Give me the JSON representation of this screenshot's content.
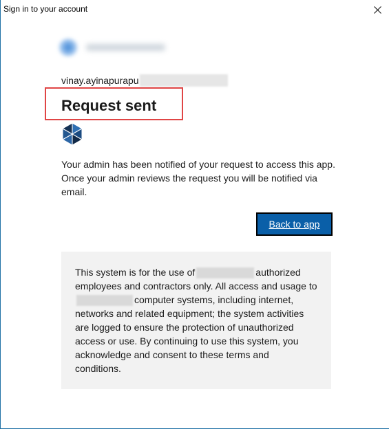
{
  "window": {
    "title": "Sign in to your account",
    "close_glyph": "close-icon"
  },
  "account": {
    "email_visible": "vinay.ayinapurapu"
  },
  "main": {
    "heading": "Request sent",
    "app_icon": "app-icon",
    "message": "Your admin has been notified of your request to access this app. Once your admin reviews the request you will be notified via email.",
    "back_button_label": "Back to app"
  },
  "notice": {
    "part1": "This system is for the use of",
    "part2": "authorized employees and contractors only. All access and usage to",
    "part3": "computer systems, including internet, networks and related equipment; the system activities are logged to ensure the protection of unauthorized access or use. By continuing to use this system, you acknowledge and consent to these terms and conditions."
  },
  "colors": {
    "accent": "#0a5fa8",
    "highlight_border": "#e04545",
    "notice_background": "#f2f2f2",
    "window_border": "#1d6fa5"
  }
}
